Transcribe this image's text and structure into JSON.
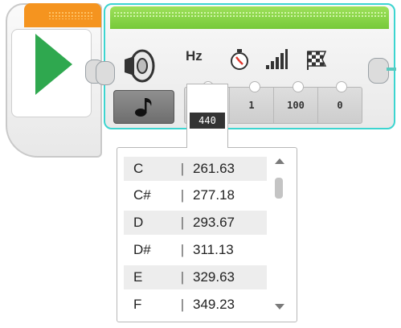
{
  "sound_block": {
    "param_icons": [
      "hz-icon",
      "timer-icon",
      "volume-icon",
      "checkered-flag-icon"
    ],
    "hz_label": "Hz",
    "frequency_value": "440",
    "params": [
      "1",
      "100",
      "0"
    ]
  },
  "note_list": [
    {
      "note": "C",
      "freq": "261.63"
    },
    {
      "note": "C#",
      "freq": "277.18"
    },
    {
      "note": "D",
      "freq": "293.67"
    },
    {
      "note": "D#",
      "freq": "311.13"
    },
    {
      "note": "E",
      "freq": "329.63"
    },
    {
      "note": "F",
      "freq": "349.23"
    }
  ],
  "colors": {
    "start_accent": "#f5941f",
    "play_green": "#2fa84f",
    "sound_accent": "#76c93a",
    "selection_outline": "#3cd5d0"
  }
}
